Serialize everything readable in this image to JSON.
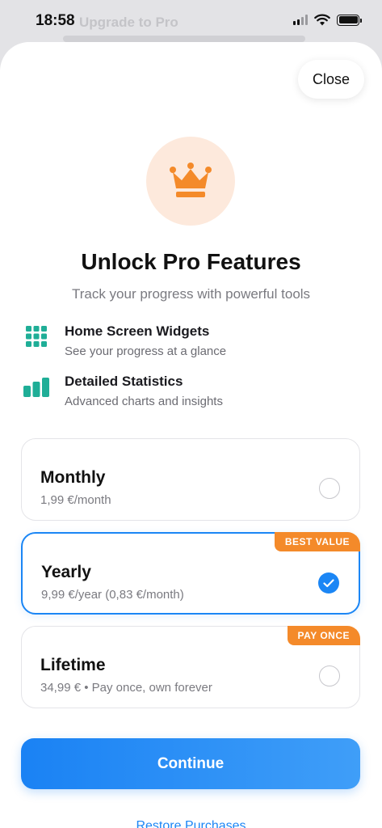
{
  "status_bar": {
    "time": "18:58"
  },
  "background_page": {
    "title": "Upgrade to Pro"
  },
  "sheet": {
    "close_label": "Close",
    "title": "Unlock Pro Features",
    "subtitle": "Track your progress with powerful tools",
    "features": [
      {
        "icon": "grid-icon",
        "title": "Home Screen Widgets",
        "description": "See your progress at a glance"
      },
      {
        "icon": "bar-chart-icon",
        "title": "Detailed Statistics",
        "description": "Advanced charts and insights"
      }
    ],
    "plans": [
      {
        "name": "Monthly",
        "price": "1,99 €/month",
        "badge": "",
        "selected": false
      },
      {
        "name": "Yearly",
        "price": "9,99 €/year (0,83 €/month)",
        "badge": "BEST VALUE",
        "selected": true
      },
      {
        "name": "Lifetime",
        "price": "34,99 € • Pay once, own forever",
        "badge": "PAY ONCE",
        "selected": false
      }
    ],
    "continue_label": "Continue",
    "restore_label": "Restore Purchases"
  },
  "colors": {
    "accent": "#1b86f5",
    "badge": "#f48a2a",
    "crown": "#f48a2a",
    "crown_bg": "#fde9dc",
    "feature_icon": "#1fae97"
  }
}
